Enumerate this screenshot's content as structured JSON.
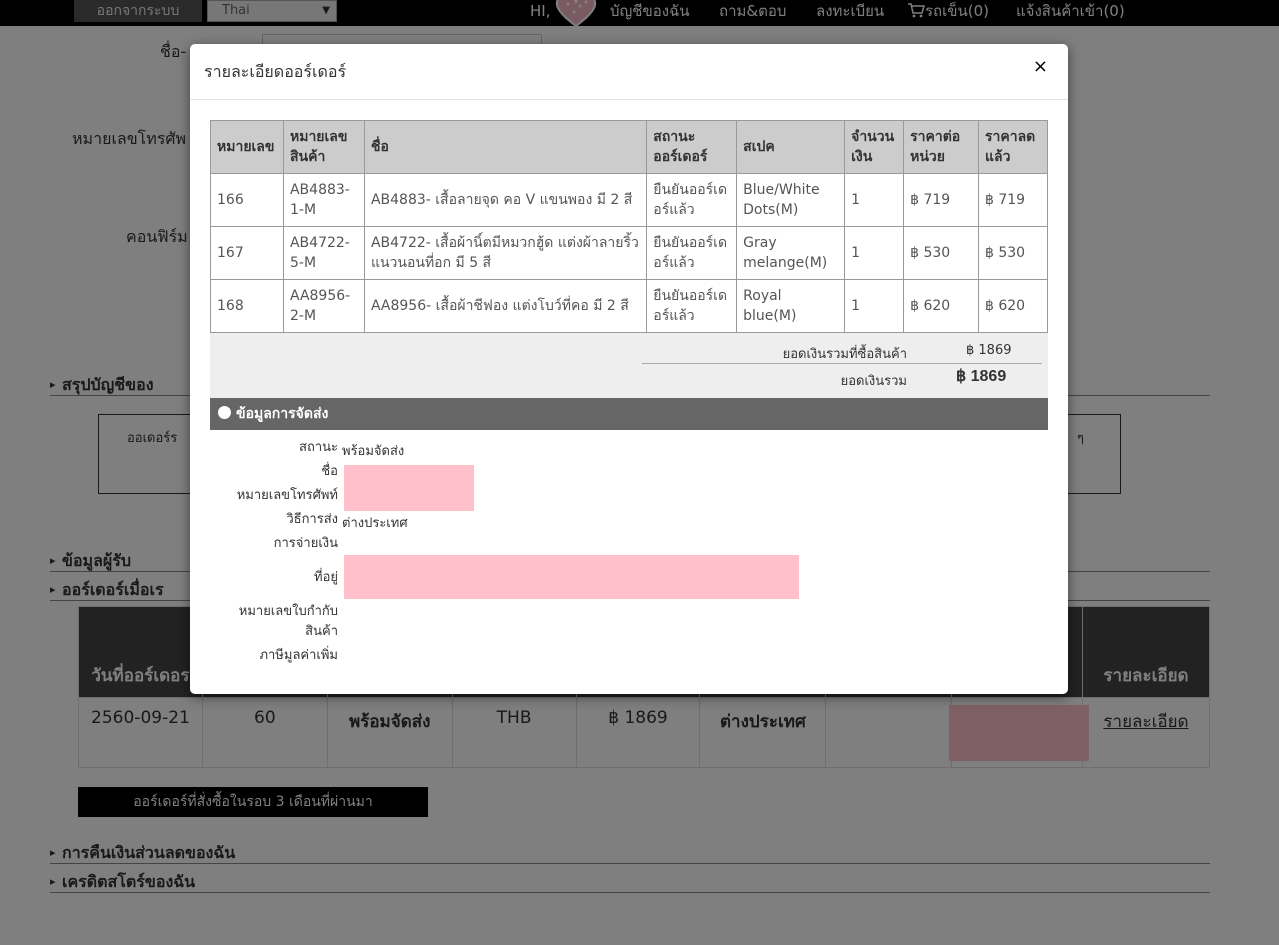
{
  "topbar": {
    "logout": "ออกจากระบบ",
    "language": "Thai",
    "greeting": "HI,",
    "my_account": "บัญชีของฉัน",
    "qa": "ถาม&ตอบ",
    "register": "ลงทะเบียน",
    "cart": "รถเข็น(0)",
    "notify": "แจ้งสินค้าเข้า(0)"
  },
  "page": {
    "name_label": "ชื่อ-",
    "phone_label": "หมายเลขโทรศัพ",
    "confirm_label": "คอนฟิร์ม",
    "summary_section": "สรุปบัญชีของ",
    "summary_box_text": "ออเดอร์ร",
    "summary_box_right": "ๆ",
    "recipient_section": "ข้อมูลผู้รับ",
    "orders_section": "ออร์เดอร์เมื่อเร",
    "order_headers": [
      "วันที่ออร์เดอร",
      "",
      "",
      "",
      "",
      "",
      "",
      "",
      "รายละเอียด"
    ],
    "order_row": {
      "date": "2560-09-21",
      "qty": "60",
      "status": "พร้อมจัดส่ง",
      "currency": "THB",
      "amount": "฿ 1869",
      "shipping": "ต่างประเทศ",
      "detail_link": "รายละเอียด"
    },
    "recent_btn": "ออร์เดอร์ที่สั่งซื้อในรอบ 3 เดือนที่ผ่านมา",
    "refund_section": "การคืนเงินส่วนลดของฉัน",
    "credit_section": "เครดิตสโตร์ของฉัน"
  },
  "modal": {
    "title": "รายละเอียดออร์เดอร์",
    "close": "×",
    "headers": [
      "หมายเลข",
      "หมายเลขสินค้า",
      "ชื่อ",
      "สถานะออร์เดอร์",
      "สเปค",
      "จำนวนเงิน",
      "ราคาต่อหน่วย",
      "ราคาลดแล้ว"
    ],
    "rows": [
      [
        "166",
        "AB4883-1-M",
        "AB4883- เสื้อลายจุด คอ V แขนพอง มี 2 สี",
        "ยืนยันออร์เดอร์แล้ว",
        "Blue/White Dots(M)",
        "1",
        "฿ 719",
        "฿ 719"
      ],
      [
        "167",
        "AB4722-5-M",
        "AB4722- เสื้อผ้านิ์ตมีหมวกฮู้ด แต่งผ้าลายริ้วแนวนอนที่อก มี 5 สี",
        "ยืนยันออร์เดอร์แล้ว",
        "Gray melange(M)",
        "1",
        "฿ 530",
        "฿ 530"
      ],
      [
        "168",
        "AA8956-2-M",
        "AA8956- เสื้อผ้าชีฟอง แต่งโบว์ที่คอ มี 2 สี",
        "ยืนยันออร์เดอร์แล้ว",
        "Royal blue(M)",
        "1",
        "฿ 620",
        "฿ 620"
      ]
    ],
    "subtotal_label": "ยอดเงินรวมที่ซื้อสินค้า",
    "subtotal_value": "฿ 1869",
    "total_label": "ยอดเงินรวม",
    "total_value": "฿ 1869",
    "shipping_header": "ข้อมูลการจัดส่ง",
    "ship": {
      "status_label": "สถานะ",
      "status_value": "พร้อมจัดส่ง",
      "name_label": "ชื่อ",
      "phone_label": "หมายเลขโทรศัพท์",
      "method_label": "วิธีการส่ง",
      "method_value": "ต่างประเทศ",
      "payment_label": "การจ่ายเงิน",
      "address_label": "ที่อยู่",
      "invoice_label_1": "หมายเลขใบกำกับ",
      "invoice_label_2": "สินค้า",
      "vat_label": "ภาษีมูลค่าเพิ่ม"
    }
  },
  "colors": {
    "redaction": "#ffc0cb",
    "topbar": "#000000",
    "shipping_header": "#666666"
  }
}
